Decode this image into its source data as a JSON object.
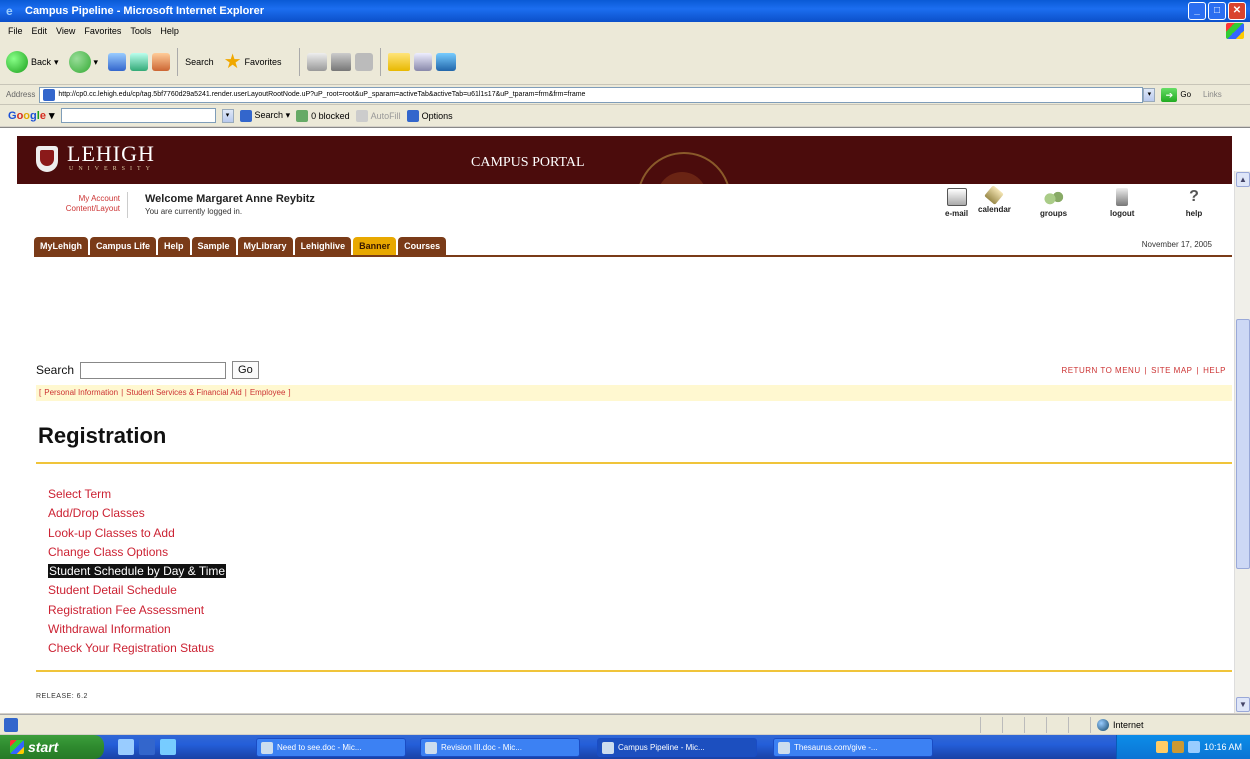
{
  "window": {
    "title": "Campus Pipeline - Microsoft Internet Explorer",
    "controls": [
      "_",
      "□",
      "✕"
    ]
  },
  "menubar": [
    "File",
    "Edit",
    "View",
    "Favorites",
    "Tools",
    "Help"
  ],
  "toolbar": {
    "back": "Back",
    "search": "Search",
    "favorites": "Favorites"
  },
  "address": {
    "label": "Address",
    "url": "http://cp0.cc.lehigh.edu/cp/tag.5bf7760d29a5241.render.userLayoutRootNode.uP?uP_root=root&uP_sparam=activeTab&activeTab=u61l1s17&uP_tparam=frm&frm=frame",
    "go": "Go",
    "links": "Links"
  },
  "googlebar": {
    "logo": [
      "G",
      "o",
      "o",
      "g",
      "l",
      "e"
    ],
    "logo_suffix": "▾",
    "search_btn": "Search ▾",
    "blocked": "0 blocked",
    "autofill": "AutoFill",
    "options": "Options"
  },
  "banner": {
    "university": "LEHIGH",
    "university_sub": "UNIVERSITY",
    "portal": "CAMPUS PORTAL"
  },
  "account": {
    "my_account": "My Account",
    "content_layout": "Content/Layout",
    "welcome": "Welcome Margaret Anne Reybitz",
    "logged_in": "You are currently logged in."
  },
  "quick_links": {
    "email": "e-mail",
    "calendar": "calendar",
    "groups": "groups",
    "logout": "logout",
    "help": "help"
  },
  "tabs": [
    {
      "label": "MyLehigh",
      "active": false
    },
    {
      "label": "Campus Life",
      "active": false
    },
    {
      "label": "Help",
      "active": false
    },
    {
      "label": "Sample",
      "active": false
    },
    {
      "label": "MyLibrary",
      "active": false
    },
    {
      "label": "Lehighlive",
      "active": false
    },
    {
      "label": "Banner",
      "active": true
    },
    {
      "label": "Courses",
      "active": false
    }
  ],
  "date": "November 17, 2005",
  "search": {
    "label": "Search",
    "go": "Go"
  },
  "top_links": {
    "return": "RETURN TO MENU",
    "sitemap": "SITE MAP",
    "help": "HELP"
  },
  "crumbs": {
    "personal": "Personal Information",
    "student": "Student Services & Financial Aid",
    "employee": "Employee"
  },
  "page_title": "Registration",
  "menu_items": [
    "Select Term",
    "Add/Drop Classes",
    "Look-up Classes to Add",
    "Change Class Options",
    "Student Schedule by Day & Time",
    "Student Detail Schedule",
    "Registration Fee Assessment",
    "Withdrawal Information",
    "Check Your Registration Status"
  ],
  "selected_menu_index": 4,
  "release": "RELEASE: 6.2",
  "status": {
    "zone": "Internet"
  },
  "taskbar": {
    "start": "start",
    "tasks": [
      {
        "label": "Need to see.doc - Mic...",
        "active": false
      },
      {
        "label": "Revision III.doc - Mic...",
        "active": false
      },
      {
        "label": "Campus Pipeline - Mic...",
        "active": true
      },
      {
        "label": "Thesaurus.com/give -...",
        "active": false
      }
    ],
    "clock": "10:16 AM"
  }
}
